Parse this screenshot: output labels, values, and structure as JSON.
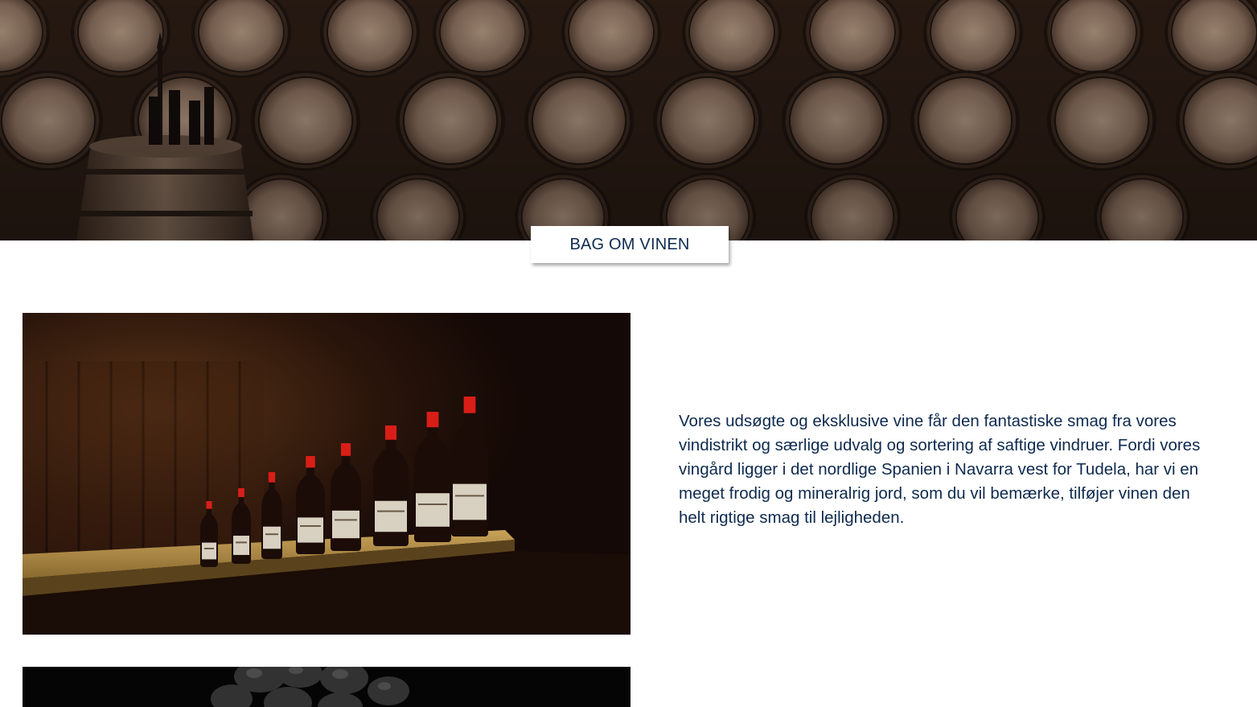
{
  "hero": {
    "image": "wine-cellar-barrels-photo"
  },
  "section": {
    "title": "BAG OM VINEN"
  },
  "content": {
    "image": "wine-bottles-on-shelf-photo",
    "description": "Vores udsøgte og eksklusive vine får den fantastiske smag fra vores vindistrikt og særlige udvalg og sortering af saftige vindruer. Fordi vores vingård ligger i det nordlige Spanien i Navarra vest for Tudela, har vi en meget frodig og mineralrig jord, som du vil bemærke, tilføjer vinen den helt rigtige smag til lejligheden."
  },
  "next_section": {
    "image": "dark-grapes-photo"
  },
  "colors": {
    "text": "#0e2a4f",
    "background": "#ffffff",
    "bottle_cap": "#d91e18"
  }
}
